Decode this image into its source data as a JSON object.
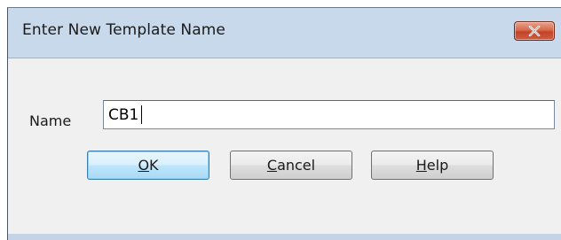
{
  "window": {
    "title": "Enter New Template Name",
    "close_icon": "close-icon"
  },
  "form": {
    "name_label": "Name",
    "name_value": "CB1"
  },
  "buttons": {
    "ok": {
      "mnemonic": "O",
      "rest": "K"
    },
    "cancel": {
      "mnemonic": "C",
      "rest": "ancel"
    },
    "help": {
      "mnemonic": "H",
      "rest": "elp"
    }
  },
  "colors": {
    "close_button": "#c2432a",
    "default_button_border": "#3c7fb1",
    "titlebar": "#c9d9ec"
  }
}
